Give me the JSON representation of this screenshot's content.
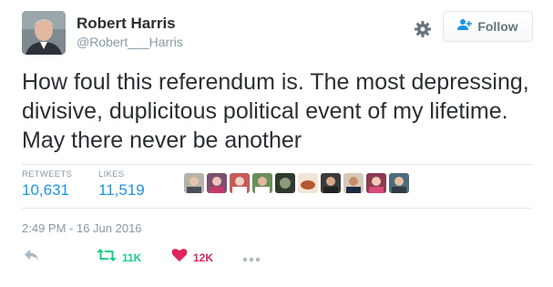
{
  "user": {
    "full_name": "Robert Harris",
    "username": "@Robert___Harris"
  },
  "actions_header": {
    "follow_label": "Follow",
    "icons": [
      "gear-icon",
      "follow-person-icon"
    ]
  },
  "tweet": {
    "text": "How foul this referendum is. The most depressing, divisive, duplicitous political event of my lifetime. May there never be another",
    "timestamp": "2:49 PM - 16 Jun 2016"
  },
  "stats": {
    "retweets_label": "RETWEETS",
    "retweets_value": "10,631",
    "likes_label": "LIKES",
    "likes_value": "11,519"
  },
  "footer": {
    "retweet_count": "11K",
    "like_count": "12K",
    "icons": [
      "reply-icon",
      "retweet-icon",
      "heart-icon",
      "more-icon"
    ]
  },
  "colors": {
    "link_blue": "#1b95e0",
    "retweet_green": "#19cf86",
    "heart_red": "#e0245e",
    "muted": "#8899a6"
  }
}
